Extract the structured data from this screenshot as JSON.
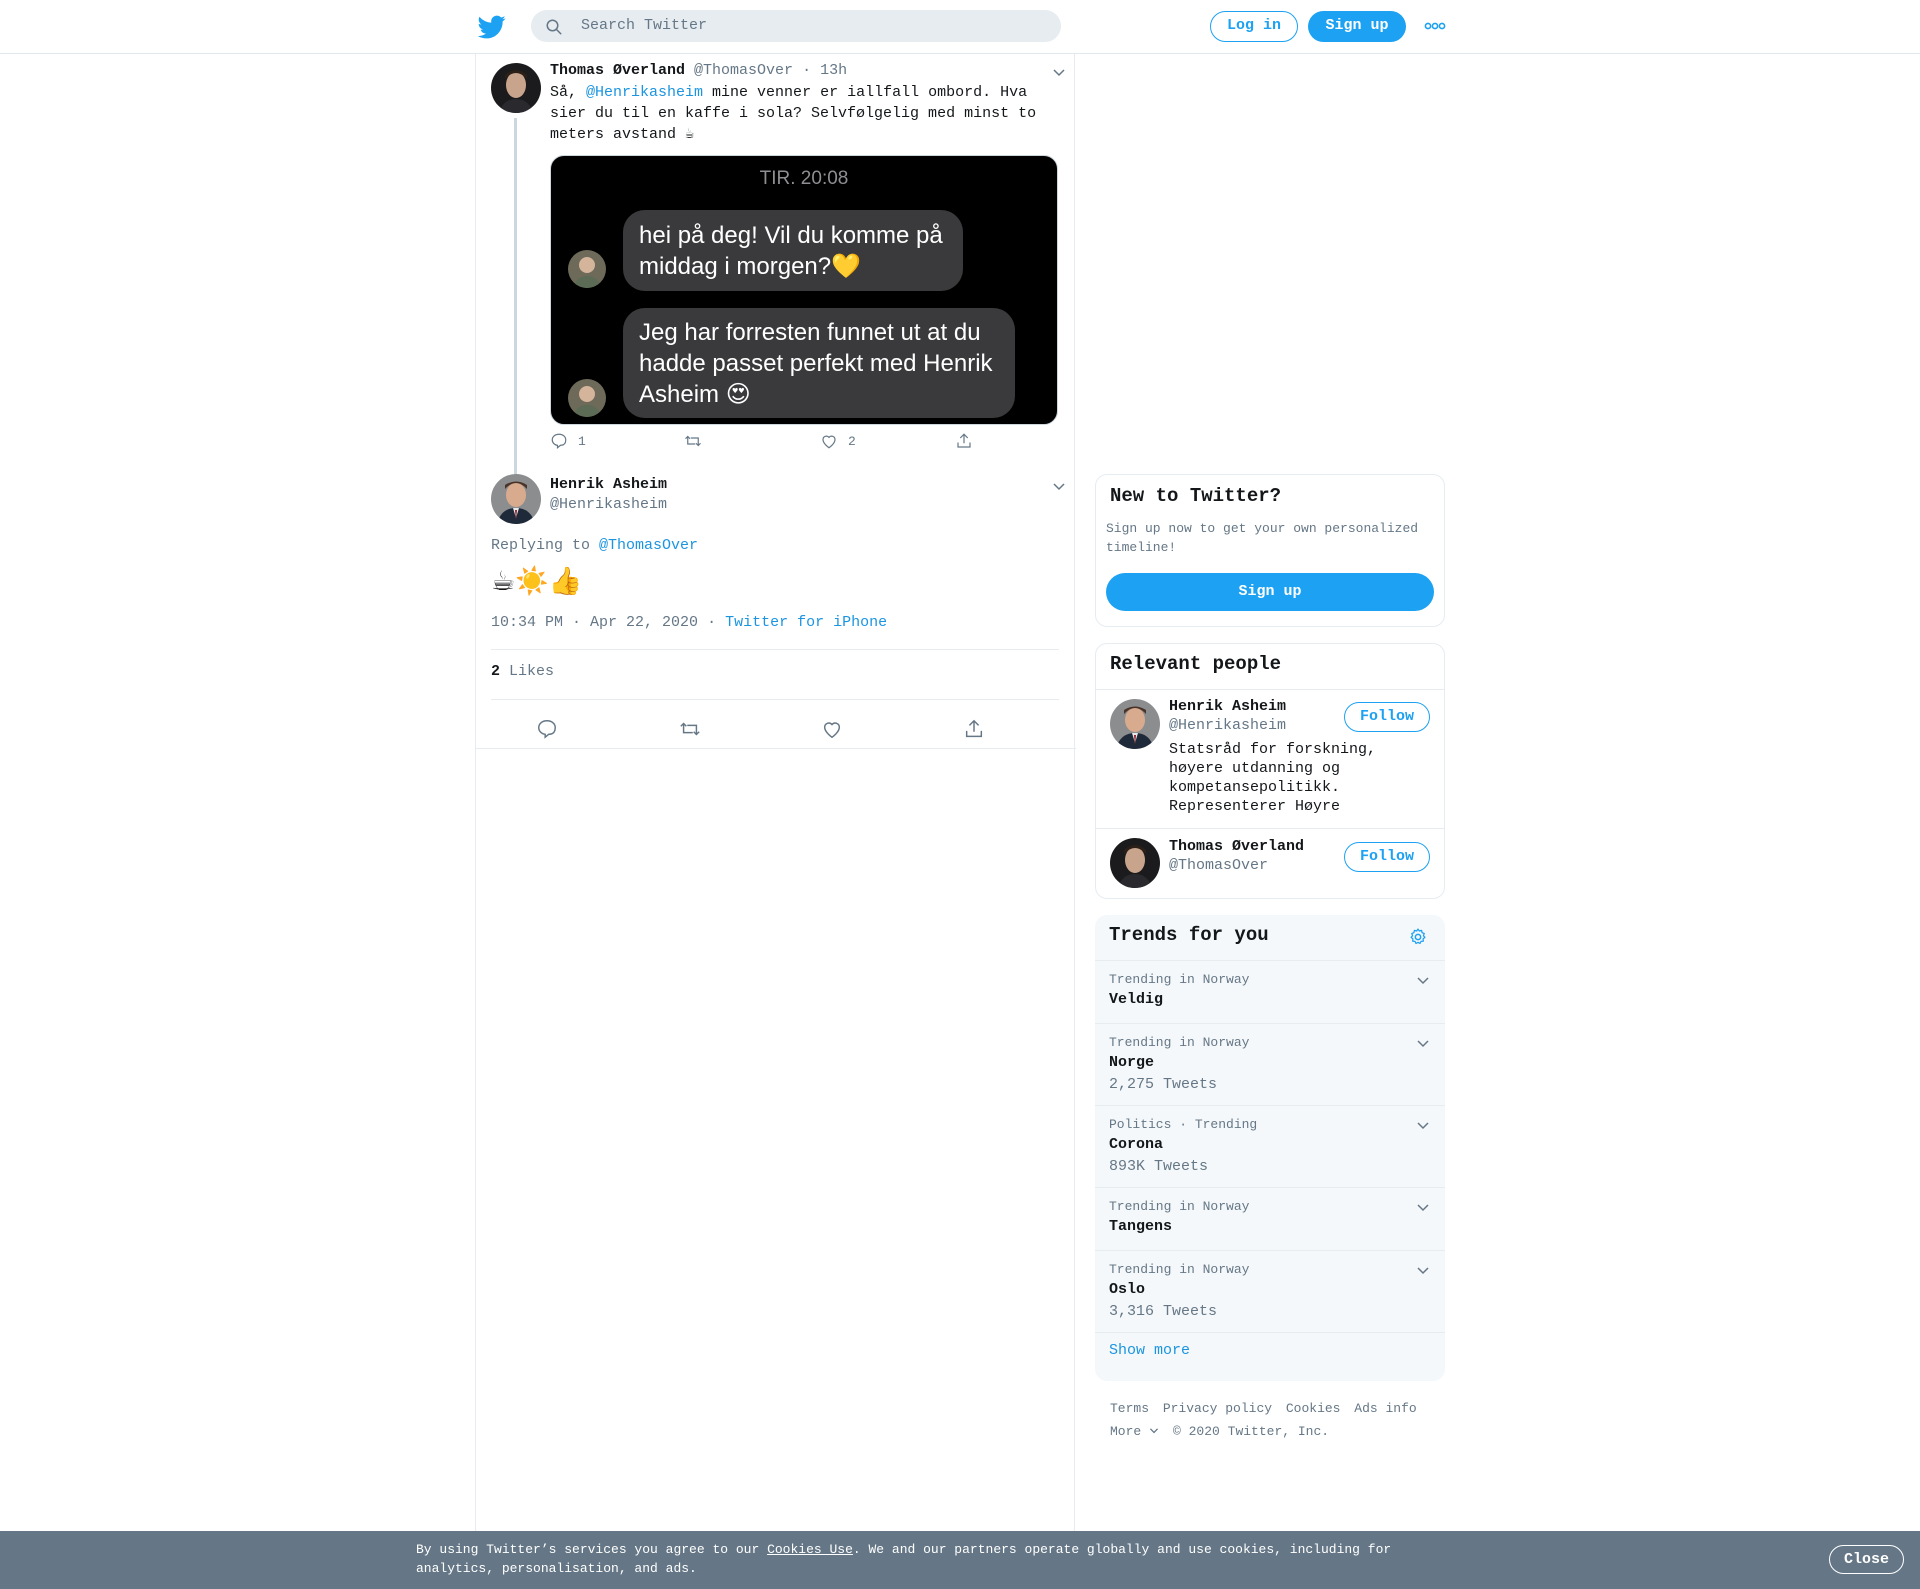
{
  "header": {
    "search_placeholder": "Search Twitter",
    "login_label": "Log in",
    "signup_label": "Sign up"
  },
  "thread": {
    "parent": {
      "name": "Thomas Øverland",
      "handle": "@ThomasOver",
      "separator": "·",
      "time": "13h",
      "text_prefix": "Så, ",
      "mention": "@Henrikasheim",
      "text_suffix": " mine venner er iallfall ombord. Hva sier du til en kaffe i sola? Selvfølgelig med minst to meters avstand ☕",
      "media": {
        "timestamp": "TIR. 20:08",
        "bubble1": "hei på deg! Vil du komme på middag i morgen?💛",
        "bubble2": "Jeg har forresten funnet ut at du hadde passet perfekt med Henrik Asheim 😍"
      },
      "reply_count": "1",
      "like_count": "2"
    },
    "focus": {
      "name": "Henrik Asheim",
      "handle": "@Henrikasheim",
      "replying_label": "Replying to ",
      "replying_to": "@ThomasOver",
      "text": "☕☀️👍",
      "timestamp": "10:34 PM · Apr 22, 2020",
      "dot": "·",
      "source": "Twitter for iPhone",
      "likes_count": "2",
      "likes_label": " Likes"
    }
  },
  "sidebar": {
    "new_to": {
      "title": "New to Twitter?",
      "desc": "Sign up now to get your own personalized timeline!",
      "button": "Sign up"
    },
    "relevant": {
      "title": "Relevant people",
      "people": [
        {
          "name": "Henrik Asheim",
          "handle": "@Henrikasheim",
          "bio": "Statsråd for forskning, høyere utdanning og kompetansepolitikk. Representerer Høyre",
          "follow": "Follow"
        },
        {
          "name": "Thomas Øverland",
          "handle": "@ThomasOver",
          "bio": "",
          "follow": "Follow"
        }
      ]
    },
    "trends": {
      "title": "Trends for you",
      "items": [
        {
          "context": "Trending in Norway",
          "name": "Veldig",
          "count": ""
        },
        {
          "context": "Trending in Norway",
          "name": "Norge",
          "count": "2,275 Tweets"
        },
        {
          "context": "Politics · Trending",
          "name": "Corona",
          "count": "893K Tweets"
        },
        {
          "context": "Trending in Norway",
          "name": "Tangens",
          "count": ""
        },
        {
          "context": "Trending in Norway",
          "name": "Oslo",
          "count": "3,316 Tweets"
        }
      ],
      "show_more": "Show more"
    },
    "footer": {
      "links": [
        "Terms",
        "Privacy policy",
        "Cookies",
        "Ads info"
      ],
      "more": "More",
      "copyright": "© 2020 Twitter, Inc."
    }
  },
  "cookie_bar": {
    "text_before": "By using Twitter’s services you agree to our ",
    "link": "Cookies Use",
    "text_after": ". We and our partners operate globally and use cookies, including for analytics, personalisation, and ads.",
    "close": "Close"
  },
  "colors": {
    "accent": "#1da1f2",
    "link": "#1b95e0",
    "muted": "#657786",
    "cookie_bg": "#657786"
  }
}
